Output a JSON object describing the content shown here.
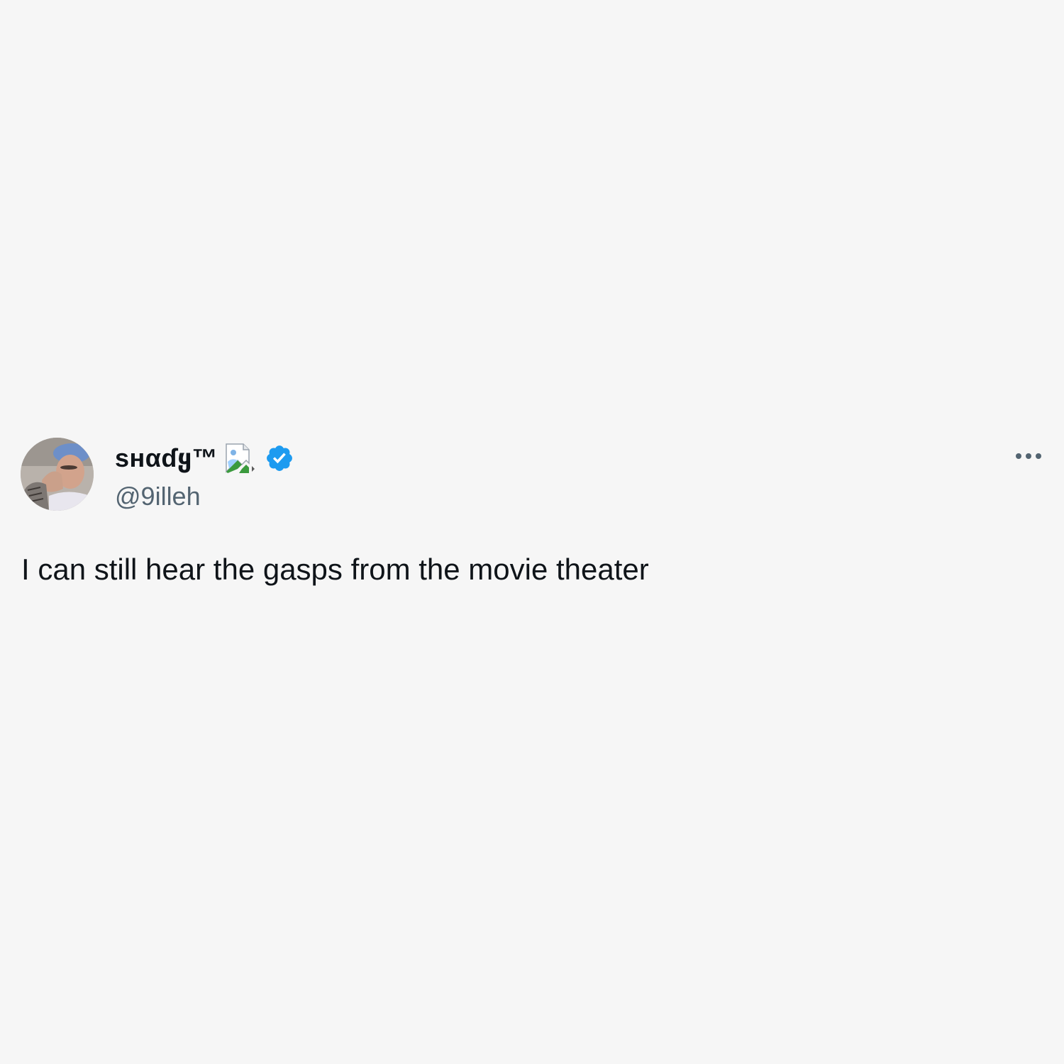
{
  "tweet": {
    "author": {
      "display_name": "sʜαɗყ™",
      "handle": "@9illeh",
      "verified": true,
      "avatar_icon": "user-avatar-photo",
      "name_badge_icon": "broken-image-icon"
    },
    "text": "I can still hear the gasps from the movie theater",
    "more_icon": "more-options-icon"
  },
  "colors": {
    "background": "#f6f6f6",
    "text_primary": "#0f1419",
    "text_secondary": "#536471",
    "verified_blue": "#1d9bf0"
  }
}
